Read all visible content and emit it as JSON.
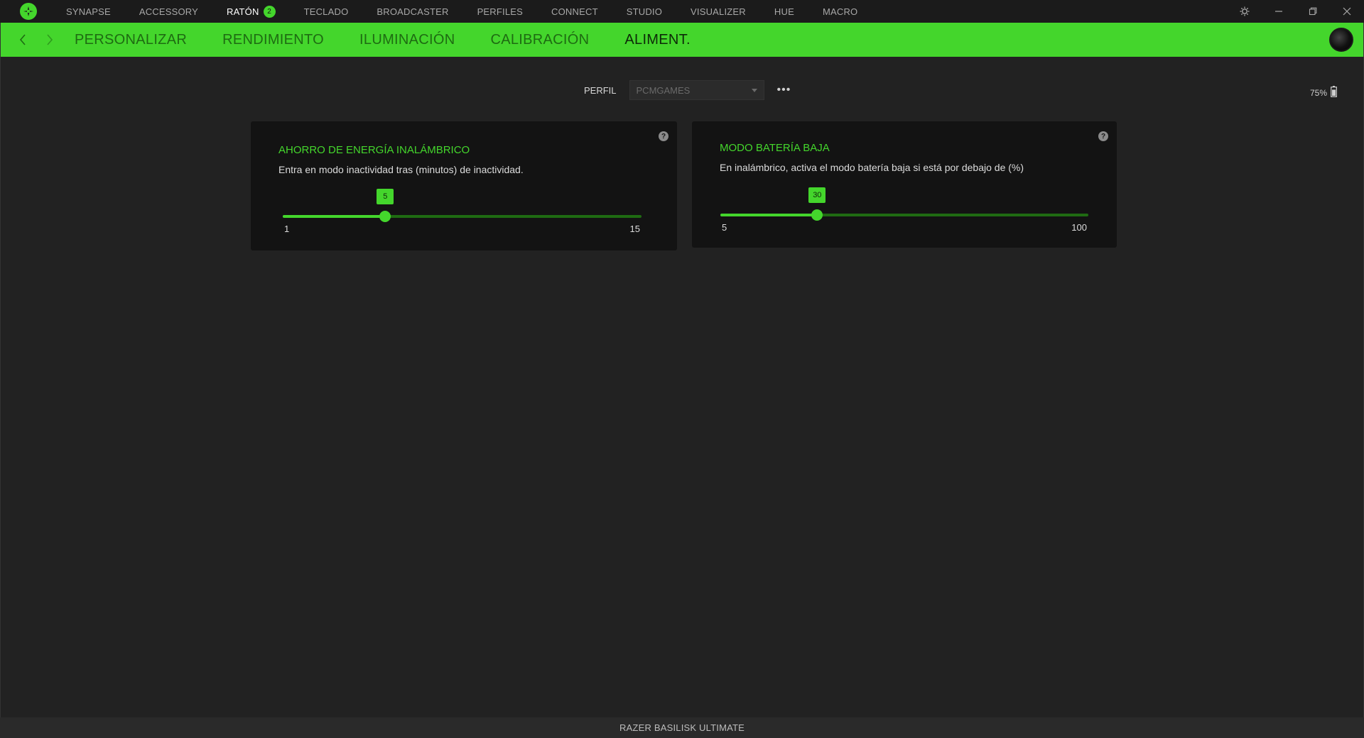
{
  "topnav": {
    "items": [
      {
        "label": "SYNAPSE"
      },
      {
        "label": "ACCESSORY"
      },
      {
        "label": "RATÓN",
        "badge": "2"
      },
      {
        "label": "TECLADO"
      },
      {
        "label": "BROADCASTER"
      },
      {
        "label": "PERFILES"
      },
      {
        "label": "CONNECT"
      },
      {
        "label": "STUDIO"
      },
      {
        "label": "VISUALIZER"
      },
      {
        "label": "HUE"
      },
      {
        "label": "MACRO"
      }
    ],
    "active_index": 2
  },
  "subnav": {
    "tabs": [
      {
        "label": "PERSONALIZAR"
      },
      {
        "label": "RENDIMIENTO"
      },
      {
        "label": "ILUMINACIÓN"
      },
      {
        "label": "CALIBRACIÓN"
      },
      {
        "label": "ALIMENT."
      }
    ],
    "active_index": 4
  },
  "profile": {
    "label": "PERFIL",
    "selected": "PCMGAMES",
    "more": "•••"
  },
  "battery": {
    "text": "75%",
    "level_percent": 75
  },
  "cards": {
    "power_saving": {
      "title": "AHORRO DE ENERGÍA INALÁMBRICO",
      "description": "Entra en modo inactividad tras (minutos) de inactividad.",
      "help": "?",
      "min": 1,
      "max": 15,
      "value": 5,
      "min_label": "1",
      "max_label": "15",
      "value_label": "5"
    },
    "low_battery": {
      "title": "MODO BATERÍA BAJA",
      "description": "En inalámbrico, activa el modo batería baja si está por debajo de (%)",
      "help": "?",
      "min": 5,
      "max": 100,
      "value": 30,
      "min_label": "5",
      "max_label": "100",
      "value_label": "30"
    }
  },
  "footer": {
    "device_name": "RAZER BASILISK ULTIMATE"
  },
  "colors": {
    "accent": "#44d62c",
    "background": "#222222",
    "card": "#131313",
    "track_dim": "#1f6b12"
  },
  "icons": {
    "logo": "razer-logo-icon",
    "settings": "gear-icon",
    "minimize": "minimize-icon",
    "maximize": "restore-icon",
    "close": "close-icon",
    "back": "chevron-left-icon",
    "forward": "chevron-right-icon",
    "battery": "battery-icon"
  }
}
